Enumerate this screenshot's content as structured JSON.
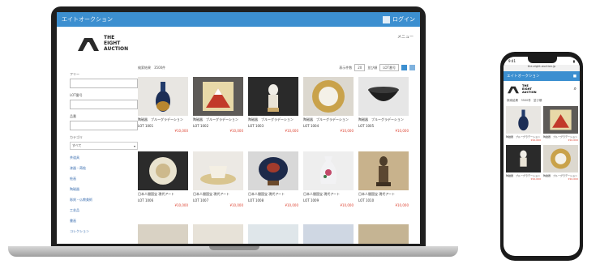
{
  "app": {
    "bar_title": "エイトオークション",
    "login_label": "ログイン",
    "menu_label": "メニュー"
  },
  "logo": {
    "line1": "THE",
    "line2": "EIGHT",
    "line3": "AUCTION"
  },
  "sidebar": {
    "fields": [
      {
        "label": "フリー"
      },
      {
        "label": "LOT番号"
      },
      {
        "label": "品番"
      }
    ],
    "category_label": "カテゴリ",
    "categories": [
      "すべて",
      "茶道具",
      "漆器・蒔絵",
      "絵画",
      "陶磁器",
      "彫刻・仏教美術",
      "工芸品",
      "書画",
      "コレクション"
    ]
  },
  "toolbar": {
    "result": "検索結果　3500件",
    "count_label": "表示件数",
    "count_value": "20",
    "sort_label": "並び順",
    "sort_value": "LOT番号"
  },
  "products": [
    {
      "name": "陶磁器　ブルーグラデーション",
      "lot": "LOT 1001",
      "price": "¥10,000"
    },
    {
      "name": "陶磁器　ブルーグラデーション",
      "lot": "LOT 1002",
      "price": "¥10,000"
    },
    {
      "name": "陶磁器　ブルーグラデーション",
      "lot": "LOT 1003",
      "price": "¥10,000"
    },
    {
      "name": "陶磁器　ブルーグラデーション",
      "lot": "LOT 1004",
      "price": "¥10,000"
    },
    {
      "name": "陶磁器　ブルーグラデーション",
      "lot": "LOT 1005",
      "price": "¥10,000"
    },
    {
      "name": "日本人間国宝 現代アート",
      "lot": "LOT 1006",
      "price": "¥10,000"
    },
    {
      "name": "日本人間国宝 現代アート",
      "lot": "LOT 1007",
      "price": "¥10,000"
    },
    {
      "name": "日本人間国宝 現代アート",
      "lot": "LOT 1008",
      "price": "¥10,000"
    },
    {
      "name": "日本人間国宝 現代アート",
      "lot": "LOT 1009",
      "price": "¥10,000"
    },
    {
      "name": "日本人間国宝 現代アート",
      "lot": "LOT 1010",
      "price": "¥10,000"
    }
  ],
  "phone": {
    "status_time": "9:41",
    "url": "the-eight-auction.jp",
    "result": "検索結果　3500件",
    "products": [
      {
        "name": "陶磁器　ブルーグラデーション",
        "price": "¥10,000"
      },
      {
        "name": "陶磁器　ブルーグラデーション",
        "price": "¥10,000"
      },
      {
        "name": "陶磁器　ブルーグラデーション",
        "price": "¥10,000"
      },
      {
        "name": "陶磁器　ブルーグラデーション",
        "price": "¥10,000"
      }
    ]
  },
  "colors": {
    "accent": "#3c8fd0",
    "price": "#d43333"
  }
}
